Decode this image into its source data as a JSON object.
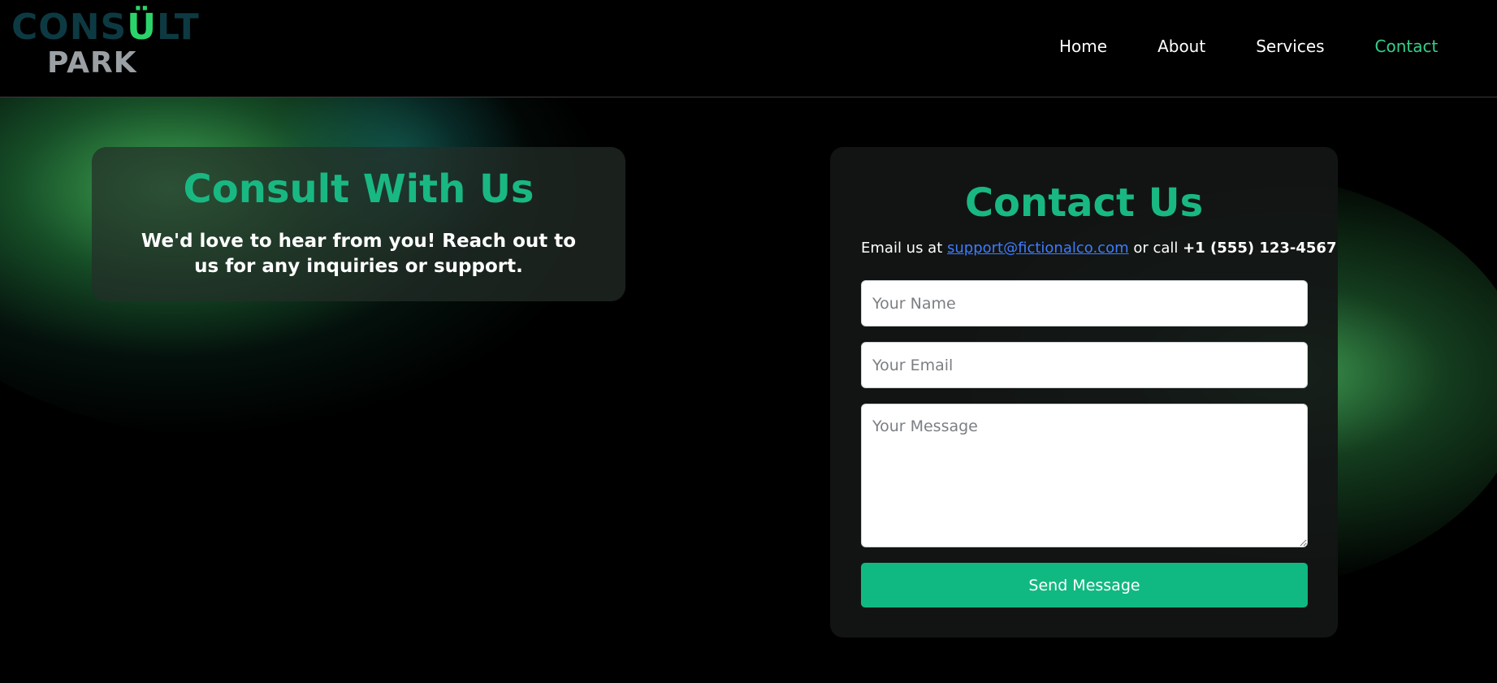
{
  "brand": {
    "logo_top_before": "CONS",
    "logo_top_accent": "Ü",
    "logo_top_after": "LT",
    "logo_bottom": "PARK"
  },
  "nav": {
    "items": [
      {
        "label": "Home",
        "active": false
      },
      {
        "label": "About",
        "active": false
      },
      {
        "label": "Services",
        "active": false
      },
      {
        "label": "Contact",
        "active": true
      }
    ]
  },
  "consult": {
    "title": "Consult With Us",
    "text": "We'd love to hear from you! Reach out to us for any inquiries or support."
  },
  "contact": {
    "title": "Contact Us",
    "line_prefix": "Email us at",
    "email": "support@fictionalco.com",
    "line_middle": "or call",
    "phone": "+1 (555) 123-4567",
    "name_placeholder": "Your Name",
    "email_placeholder": "Your Email",
    "message_placeholder": "Your Message",
    "submit_label": "Send Message"
  },
  "colors": {
    "accent": "#10b981",
    "title": "#19b882",
    "nav_active": "#35d08a",
    "link": "#3d7cff",
    "background": "#000000"
  }
}
